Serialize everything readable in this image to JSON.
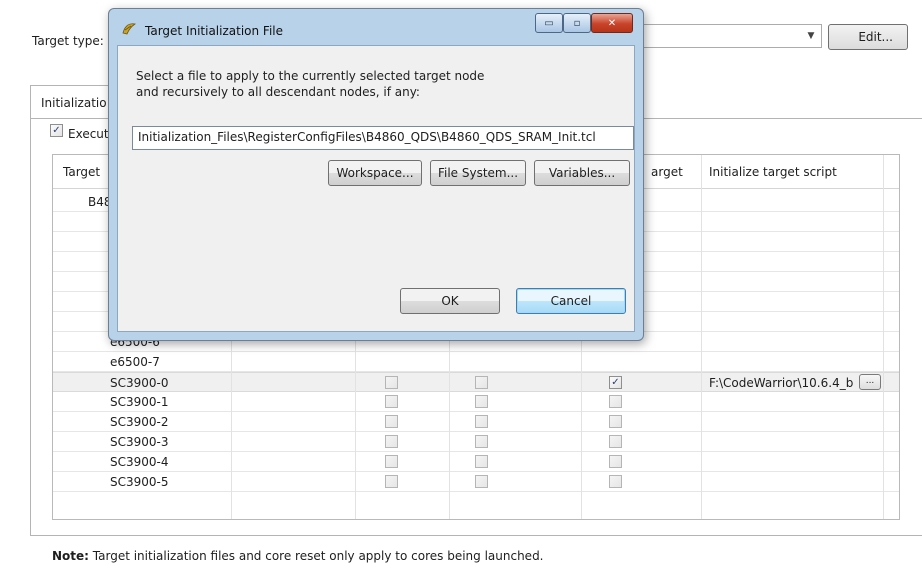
{
  "background": {
    "target_type_label": "Target type:",
    "edit_button": "Edit...",
    "tab_label": "Initializatio",
    "execute_label": "Execut",
    "table": {
      "headers": {
        "target": "Target",
        "arget": "arget",
        "init_script": "Initialize target script"
      },
      "rows": [
        {
          "name": "B48",
          "check1": null,
          "check2": null,
          "check3": null,
          "script": ""
        },
        {
          "name": "",
          "check1": null,
          "check2": null,
          "check3": null,
          "script": ""
        },
        {
          "name": "",
          "check1": null,
          "check2": null,
          "check3": null,
          "script": ""
        },
        {
          "name": "",
          "check1": null,
          "check2": null,
          "check3": null,
          "script": ""
        },
        {
          "name": "",
          "check1": null,
          "check2": null,
          "check3": null,
          "script": ""
        },
        {
          "name": "",
          "check1": null,
          "check2": null,
          "check3": null,
          "script": ""
        },
        {
          "name": "",
          "check1": null,
          "check2": null,
          "check3": null,
          "script": ""
        },
        {
          "name": "e6500-6",
          "check1": null,
          "check2": null,
          "check3": null,
          "script": ""
        },
        {
          "name": "e6500-7",
          "check1": null,
          "check2": null,
          "check3": null,
          "script": ""
        },
        {
          "name": "SC3900-0",
          "check1": false,
          "check2": false,
          "check3": true,
          "script": "F:\\CodeWarrior\\10.6.4_b",
          "browse": "..."
        },
        {
          "name": "SC3900-1",
          "check1": false,
          "check2": false,
          "check3": false,
          "script": ""
        },
        {
          "name": "SC3900-2",
          "check1": false,
          "check2": false,
          "check3": false,
          "script": ""
        },
        {
          "name": "SC3900-3",
          "check1": false,
          "check2": false,
          "check3": false,
          "script": ""
        },
        {
          "name": "SC3900-4",
          "check1": false,
          "check2": false,
          "check3": false,
          "script": ""
        },
        {
          "name": "SC3900-5",
          "check1": false,
          "check2": false,
          "check3": false,
          "script": ""
        }
      ]
    },
    "note_bold": "Note:",
    "note_text": " Target initialization files and core reset only apply to cores being launched."
  },
  "dialog": {
    "title": "Target Initialization File",
    "message_line1": "Select a file to apply to the currently selected target node",
    "message_line2": "and recursively to all descendant nodes, if any:",
    "path_value": "Initialization_Files\\RegisterConfigFiles\\B4860_QDS\\B4860_QDS_SRAM_Init.tcl",
    "workspace_button": "Workspace...",
    "filesystem_button": "File System...",
    "variables_button": "Variables...",
    "ok_button": "OK",
    "cancel_button": "Cancel",
    "minimize_glyph": "▭",
    "maximize_glyph": "▫",
    "close_glyph": "✕"
  },
  "colors": {
    "dialog_frame": "#b8d2ea",
    "close_button": "#c8432a",
    "selected_row": "#f0f0f0"
  },
  "icons": [
    "app-icon",
    "combo-arrow-icon",
    "checkbox-icon",
    "minimize-icon",
    "maximize-icon",
    "close-icon"
  ]
}
